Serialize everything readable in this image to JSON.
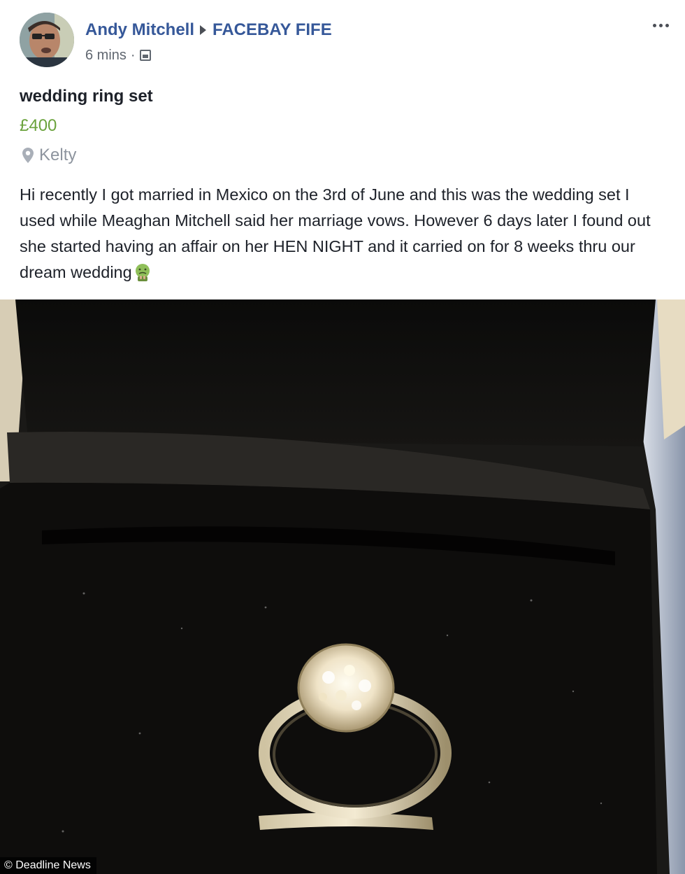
{
  "post": {
    "author": "Andy Mitchell",
    "group": "FACEBAY FIFE",
    "timestamp": "6 mins",
    "separator": "·",
    "privacy_icon": "photo-icon",
    "more_icon": "more-options-icon"
  },
  "listing": {
    "title": "wedding ring set",
    "price": "£400",
    "location": "Kelty",
    "location_icon": "map-pin-icon",
    "description": "Hi recently I got married in Mexico on the 3rd of June and this was the wedding set I used while Meaghan Mitchell said her marriage vows. However 6 days later I found out she started having an affair on her HEN NIGHT and it carried on for 8 weeks thru our dream wedding",
    "description_emoji": "nauseated-face-emoji"
  },
  "photo": {
    "credit": "© Deadline News"
  },
  "colors": {
    "link": "#365899",
    "price": "#6ba33d",
    "muted": "#606770",
    "text": "#1d2129"
  }
}
